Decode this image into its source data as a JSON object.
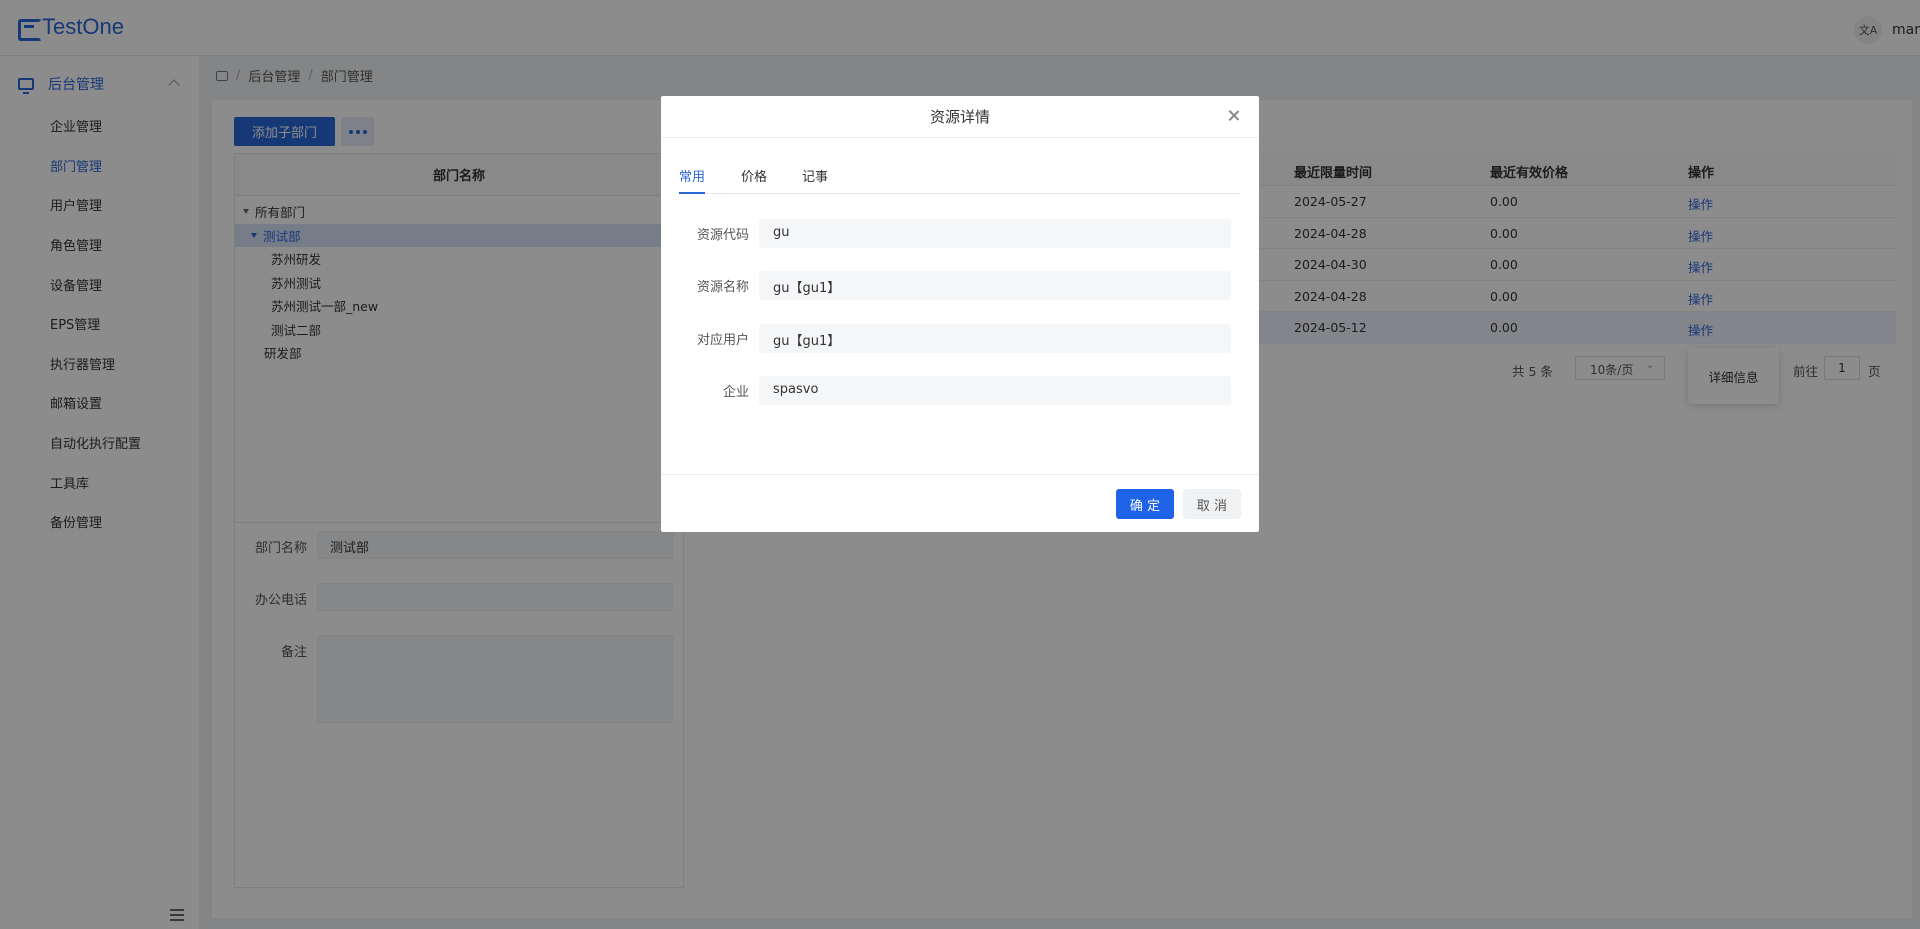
{
  "app": {
    "name": "TestOne",
    "user": "mana"
  },
  "colors": {
    "accent": "#2b66d9",
    "overlay": "rgba(0,0,0,0.45)",
    "primary_button": "#1f63e8"
  },
  "sidebar": {
    "root": {
      "label": "后台管理",
      "icon": "monitor-icon"
    },
    "items": [
      {
        "label": "企业管理"
      },
      {
        "label": "部门管理"
      },
      {
        "label": "用户管理"
      },
      {
        "label": "角色管理"
      },
      {
        "label": "设备管理"
      },
      {
        "label": "EPS管理"
      },
      {
        "label": "执行器管理"
      },
      {
        "label": "邮箱设置"
      },
      {
        "label": "自动化执行配置"
      },
      {
        "label": "工具库"
      },
      {
        "label": "备份管理"
      }
    ],
    "active_index": 1
  },
  "breadcrumb": {
    "items": [
      "后台管理",
      "部门管理"
    ]
  },
  "toolbar": {
    "add_label": "添加子部门"
  },
  "tree": {
    "header": "部门名称",
    "nodes": [
      {
        "label": "所有部门",
        "level": 0,
        "expanded": true
      },
      {
        "label": "测试部",
        "level": 1,
        "expanded": true,
        "selected": true
      },
      {
        "label": "苏州研发",
        "level": 2
      },
      {
        "label": "苏州测试",
        "level": 2
      },
      {
        "label": "苏州测试一部_new",
        "level": 2
      },
      {
        "label": "测试二部",
        "level": 2
      },
      {
        "label": "研发部",
        "level": 1
      }
    ]
  },
  "dept_form": {
    "name_label": "部门名称",
    "name_value": "测试部",
    "phone_label": "办公电话",
    "phone_value": "",
    "note_label": "备注"
  },
  "table": {
    "columns": [
      "最近限量时间",
      "最近有效价格",
      "操作"
    ],
    "rows": [
      {
        "time": "2024-05-27",
        "price": "0.00",
        "action": "操作"
      },
      {
        "time": "2024-04-28",
        "price": "0.00",
        "action": "操作"
      },
      {
        "time": "2024-04-30",
        "price": "0.00",
        "action": "操作"
      },
      {
        "time": "2024-04-28",
        "price": "0.00",
        "action": "操作"
      },
      {
        "time": "2024-05-12",
        "price": "0.00",
        "action": "操作"
      }
    ],
    "pager": {
      "total": "共 5 条",
      "page_size": "10条/页",
      "goto_prefix": "前往",
      "goto_value": "1",
      "goto_suffix": "页"
    }
  },
  "popover": {
    "label": "详细信息"
  },
  "modal": {
    "title": "资源详情",
    "tabs": [
      {
        "label": "常用"
      },
      {
        "label": "价格"
      },
      {
        "label": "记事"
      }
    ],
    "fields": [
      {
        "label": "资源代码",
        "value": "gu"
      },
      {
        "label": "资源名称",
        "value": "gu【gu1】"
      },
      {
        "label": "对应用户",
        "value": "gu【gu1】"
      },
      {
        "label": "企业",
        "value": "spasvo"
      }
    ],
    "ok_label": "确 定",
    "cancel_label": "取 消"
  }
}
